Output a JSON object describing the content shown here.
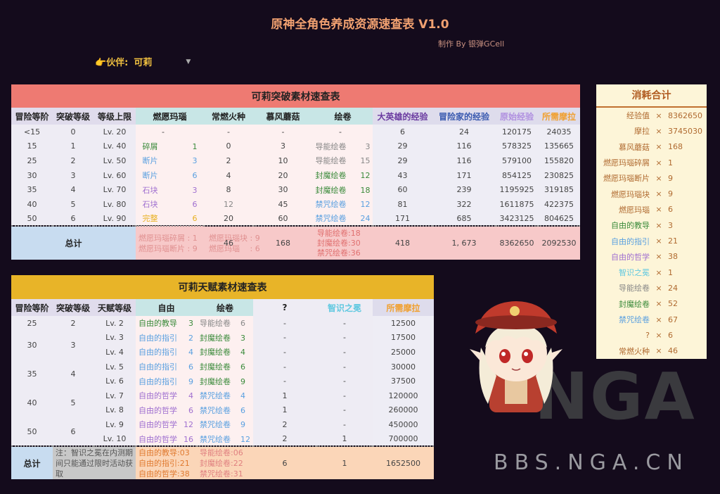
{
  "header": {
    "title": "原神全角色养成资源速查表 V1.0",
    "credit": "制作 By 银弹GCell",
    "partner_label": "👉伙伴:",
    "partner_value": "可莉"
  },
  "ascension": {
    "title": "可莉突破素材速查表",
    "columns": [
      "冒险等阶",
      "突破等级",
      "等级上限",
      "燃愿玛瑙",
      "常燃火种",
      "慕风蘑菇",
      "绘卷",
      "大英雄的经验",
      "冒险家的经验",
      "原始经验",
      "所需摩拉"
    ],
    "rows": [
      [
        "<15",
        "0",
        "Lv. 20",
        "-",
        "",
        "-",
        "-",
        "-",
        "",
        "6",
        "24",
        "120175",
        "24035"
      ],
      [
        "15",
        "1",
        "Lv. 40",
        "碎屑",
        "1",
        "0",
        "3",
        "导能绘卷",
        "3",
        "29",
        "116",
        "578325",
        "135665"
      ],
      [
        "25",
        "2",
        "Lv. 50",
        "断片",
        "3",
        "2",
        "10",
        "导能绘卷",
        "15",
        "29",
        "116",
        "579100",
        "155820"
      ],
      [
        "30",
        "3",
        "Lv. 60",
        "断片",
        "6",
        "4",
        "20",
        "封魔绘卷",
        "12",
        "43",
        "171",
        "854125",
        "230825"
      ],
      [
        "35",
        "4",
        "Lv. 70",
        "石块",
        "3",
        "8",
        "30",
        "封魔绘卷",
        "18",
        "60",
        "239",
        "1195925",
        "319185"
      ],
      [
        "40",
        "5",
        "Lv. 80",
        "石块",
        "6",
        "12",
        "45",
        "禁咒绘卷",
        "12",
        "81",
        "322",
        "1611875",
        "422375"
      ],
      [
        "50",
        "6",
        "Lv. 90",
        "完整",
        "6",
        "20",
        "60",
        "禁咒绘卷",
        "24",
        "171",
        "685",
        "3423125",
        "804625"
      ]
    ],
    "total": {
      "label": "总计",
      "gem": [
        "燃愿玛瑙碎屑 : 1",
        "燃愿玛瑙断片 : 9",
        "燃愿玛瑙块 : 9",
        "燃愿玛瑙　 : 6"
      ],
      "fire": "46",
      "mushroom": "168",
      "scrolls": [
        "导能绘卷:18",
        "封魔绘卷:30",
        "禁咒绘卷:36"
      ],
      "hero": "418",
      "adv": "1, 673",
      "exp": "8362650",
      "mora": "2092530"
    }
  },
  "talent": {
    "title": "可莉天赋素材速查表",
    "columns": [
      "冒险等阶",
      "突破等级",
      "天赋等级",
      "自由",
      "绘卷",
      "?",
      "智识之冕",
      "所需摩拉"
    ],
    "rows": [
      [
        "25",
        "2",
        "Lv. 2",
        "自由的教导",
        "3",
        "导能绘卷",
        "6",
        "-",
        "-",
        "12500"
      ],
      [
        "30",
        "3",
        "Lv. 3",
        "自由的指引",
        "2",
        "封魔绘卷",
        "3",
        "-",
        "-",
        "17500"
      ],
      [
        "",
        "",
        "Lv. 4",
        "自由的指引",
        "4",
        "封魔绘卷",
        "4",
        "-",
        "-",
        "25000"
      ],
      [
        "35",
        "4",
        "Lv. 5",
        "自由的指引",
        "6",
        "封魔绘卷",
        "6",
        "-",
        "-",
        "30000"
      ],
      [
        "",
        "",
        "Lv. 6",
        "自由的指引",
        "9",
        "封魔绘卷",
        "9",
        "-",
        "-",
        "37500"
      ],
      [
        "40",
        "5",
        "Lv. 7",
        "自由的哲学",
        "4",
        "禁咒绘卷",
        "4",
        "1",
        "-",
        "120000"
      ],
      [
        "",
        "",
        "Lv. 8",
        "自由的哲学",
        "6",
        "禁咒绘卷",
        "6",
        "1",
        "-",
        "260000"
      ],
      [
        "50",
        "6",
        "Lv. 9",
        "自由的哲学",
        "12",
        "禁咒绘卷",
        "9",
        "2",
        "-",
        "450000"
      ],
      [
        "",
        "",
        "Lv. 10",
        "自由的哲学",
        "16",
        "禁咒绘卷",
        "12",
        "2",
        "1",
        "700000"
      ]
    ],
    "total": {
      "label": "总计",
      "note": "注：智识之冕在内测期间只能通过限时活动获取",
      "books": [
        "自由的教导:03",
        "自由的指引:21",
        "自由的哲学:38"
      ],
      "scrolls": [
        "导能绘卷:06",
        "封魔绘卷:22",
        "禁咒绘卷:31"
      ],
      "q": "6",
      "crown": "1",
      "mora": "1652500"
    }
  },
  "summary": {
    "title": "消耗合计",
    "x": "×",
    "items": [
      {
        "k": "经验值",
        "v": "8362650",
        "c": "#b06a30"
      },
      {
        "k": "摩拉",
        "v": "3745030",
        "c": "#b06a30"
      },
      {
        "k": "慕风蘑菇",
        "v": "168",
        "c": "#b06a30"
      },
      {
        "k": "燃愿玛瑙碎屑",
        "v": "1",
        "c": "#b06a30"
      },
      {
        "k": "燃愿玛瑙断片",
        "v": "9",
        "c": "#b06a30"
      },
      {
        "k": "燃愿玛瑙块",
        "v": "9",
        "c": "#b06a30"
      },
      {
        "k": "燃愿玛瑙",
        "v": "6",
        "c": "#b06a30"
      },
      {
        "k": "自由的教导",
        "v": "3",
        "c": "#3a8a3a"
      },
      {
        "k": "自由的指引",
        "v": "21",
        "c": "#5aa0e0"
      },
      {
        "k": "自由的哲学",
        "v": "38",
        "c": "#a070d0"
      },
      {
        "k": "智识之冕",
        "v": "1",
        "c": "#5fc8e0"
      },
      {
        "k": "导能绘卷",
        "v": "24",
        "c": "#888888"
      },
      {
        "k": "封魔绘卷",
        "v": "52",
        "c": "#3a8a3a"
      },
      {
        "k": "禁咒绘卷",
        "v": "67",
        "c": "#5aa0e0"
      },
      {
        "k": "?",
        "v": "6",
        "c": "#b06a30"
      },
      {
        "k": "常燃火种",
        "v": "46",
        "c": "#b06a30"
      }
    ]
  },
  "watermark": {
    "logo": "NGA",
    "site": "BBS.NGA.CN"
  }
}
